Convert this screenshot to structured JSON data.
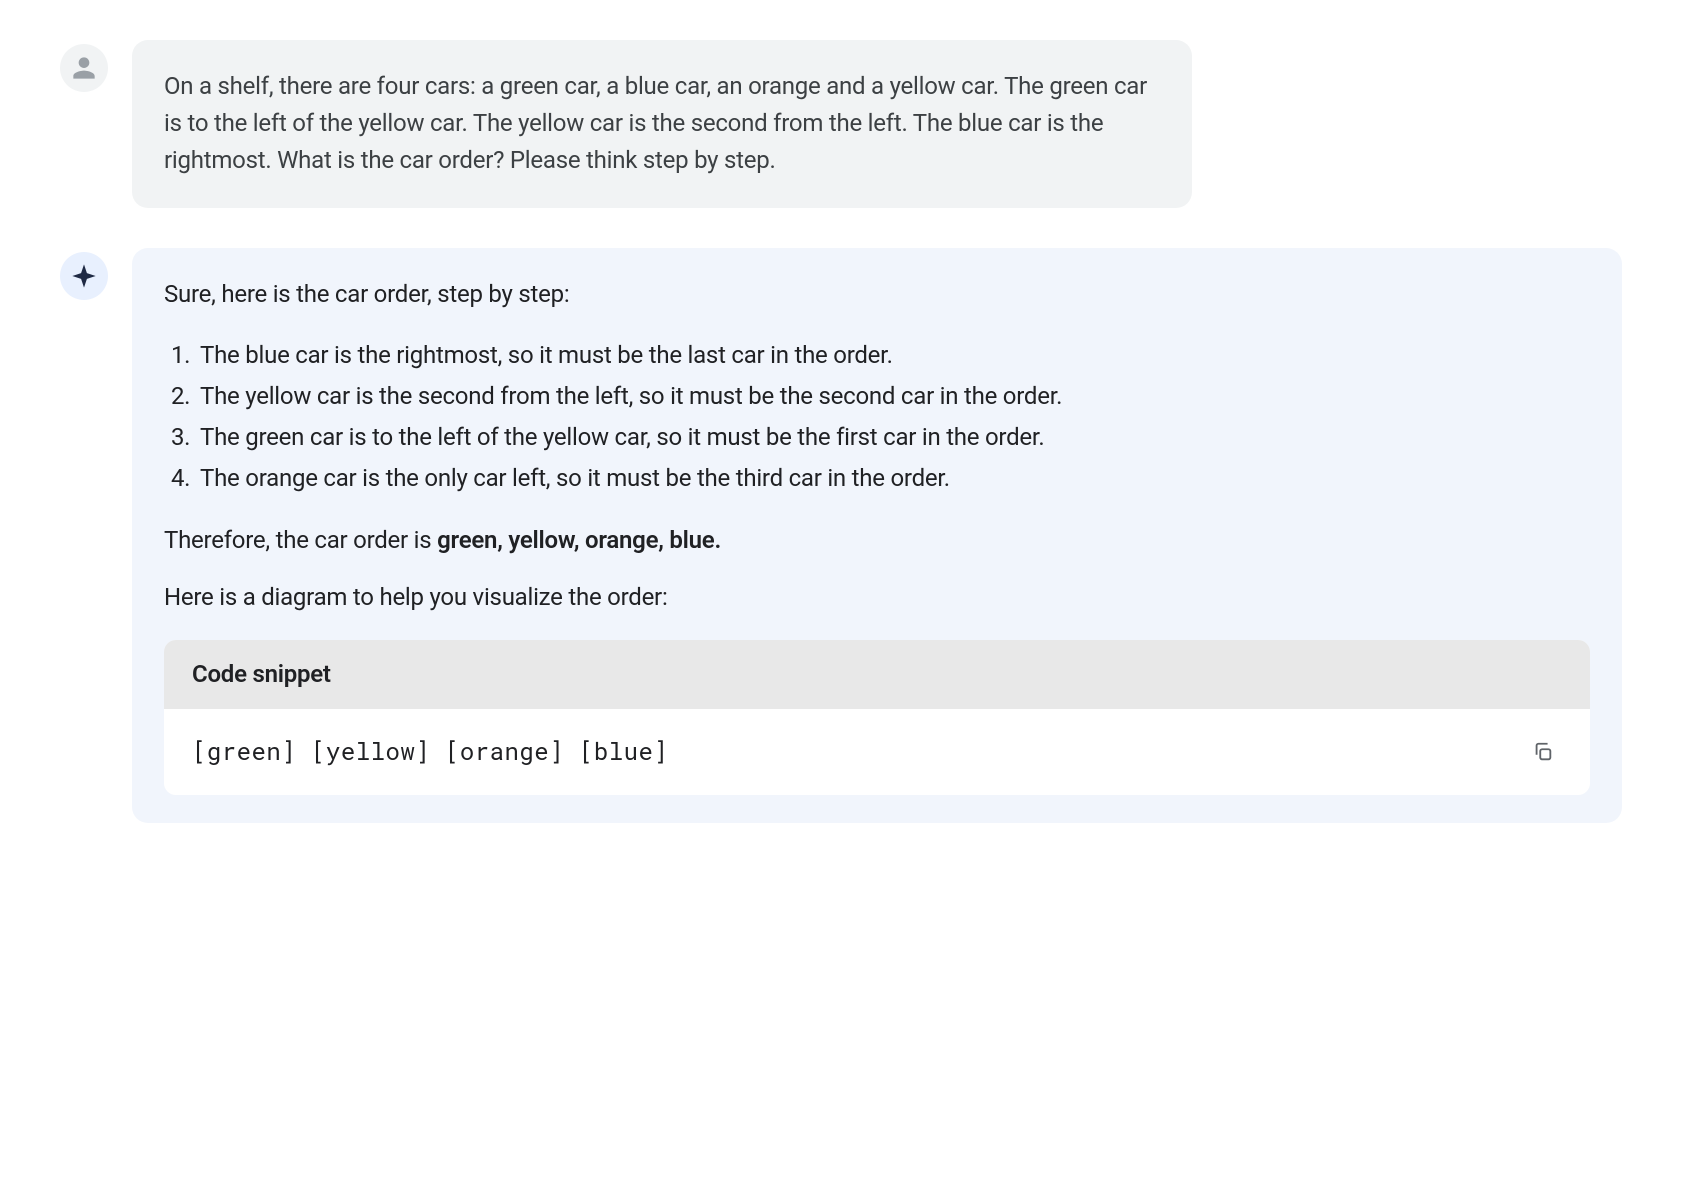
{
  "user_message": "On a shelf, there are four cars: a green car, a blue car, an orange and a yellow car. The green car is to the left of the yellow car. The yellow car is the second from the left. The blue car is the rightmost. What is the car order? Please think step by step.",
  "assistant": {
    "intro": "Sure, here is the car order, step by step:",
    "steps": [
      "The blue car is the rightmost, so it must be the last car in the order.",
      "The yellow car is the second from the left, so it must be the second car in the order.",
      "The green car is to the left of the yellow car, so it must be the first car in the order.",
      "The orange car is the only car left, so it must be the third car in the order."
    ],
    "conclusion_prefix": "Therefore, the car order is ",
    "conclusion_bold": "green, yellow, orange, blue.",
    "diagram_text": "Here is a diagram to help you visualize the order:",
    "code": {
      "header": "Code snippet",
      "content": "[green] [yellow] [orange] [blue]"
    }
  }
}
